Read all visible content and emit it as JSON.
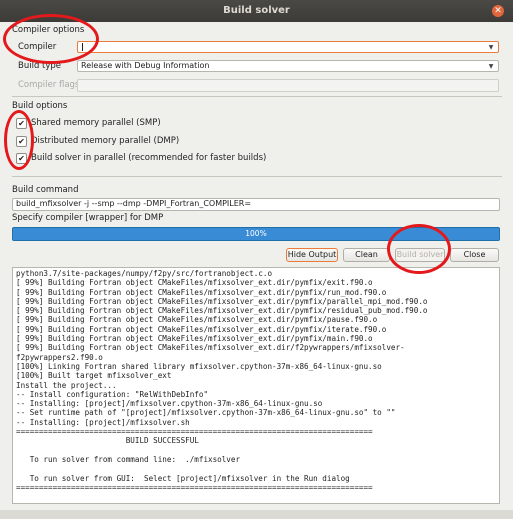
{
  "window": {
    "title": "Build solver",
    "close_glyph": "✕"
  },
  "compiler_options": {
    "section_label": "Compiler options",
    "compiler_label": "Compiler",
    "compiler_value": "",
    "build_type_label": "Build type",
    "build_type_value": "Release with Debug Information",
    "compiler_flags_label": "Compiler flags",
    "compiler_flags_value": ""
  },
  "build_options": {
    "section_label": "Build options",
    "checkboxes": [
      {
        "label": "Shared memory parallel (SMP)",
        "checked": true
      },
      {
        "label": "Distributed memory parallel (DMP)",
        "checked": true
      },
      {
        "label": "Build solver in parallel (recommended for faster builds)",
        "checked": true
      }
    ],
    "check_glyph": "✔"
  },
  "build_command": {
    "label": "Build command",
    "value": "build_mfixsolver -j --smp --dmp -DMPI_Fortran_COMPILER="
  },
  "dmp_wrapper_label": "Specify compiler [wrapper] for DMP",
  "progress": {
    "text": "100%",
    "value": 1.0
  },
  "buttons": {
    "hide_output": "Hide Output",
    "clean": "Clean",
    "build_solver": "Build solver",
    "close": "Close"
  },
  "output_lines": [
    "python3.7/site-packages/numpy/f2py/src/fortranobject.c.o",
    "[ 99%] Building Fortran object CMakeFiles/mfixsolver_ext.dir/pymfix/exit.f90.o",
    "[ 99%] Building Fortran object CMakeFiles/mfixsolver_ext.dir/pymfix/run_mod.f90.o",
    "[ 99%] Building Fortran object CMakeFiles/mfixsolver_ext.dir/pymfix/parallel_mpi_mod.f90.o",
    "[ 99%] Building Fortran object CMakeFiles/mfixsolver_ext.dir/pymfix/residual_pub_mod.f90.o",
    "[ 99%] Building Fortran object CMakeFiles/mfixsolver_ext.dir/pymfix/pause.f90.o",
    "[ 99%] Building Fortran object CMakeFiles/mfixsolver_ext.dir/pymfix/iterate.f90.o",
    "[ 99%] Building Fortran object CMakeFiles/mfixsolver_ext.dir/pymfix/main.f90.o",
    "[ 99%] Building Fortran object CMakeFiles/mfixsolver_ext.dir/f2pywrappers/mfixsolver-",
    "f2pywrappers2.f90.o",
    "[100%] Linking Fortran shared library mfixsolver.cpython-37m-x86_64-linux-gnu.so",
    "[100%] Built target mfixsolver_ext",
    "Install the project...",
    "-- Install configuration: \"RelWithDebInfo\"",
    "-- Installing: [project]/mfixsolver.cpython-37m-x86_64-linux-gnu.so",
    "-- Set runtime path of \"[project]/mfixsolver.cpython-37m-x86_64-linux-gnu.so\" to \"\"",
    "-- Installing: [project]/mfixsolver.sh",
    "==============================================================================",
    "                        BUILD SUCCESSFUL",
    "",
    "   To run solver from command line:  ./mfixsolver",
    "",
    "   To run solver from GUI:  Select [project]/mfixsolver in the Run dialog",
    "=============================================================================="
  ],
  "colors": {
    "annotation_red": "#e3191c",
    "progress_blue": "#3a8bd6",
    "focus_orange": "#e97c3b"
  }
}
